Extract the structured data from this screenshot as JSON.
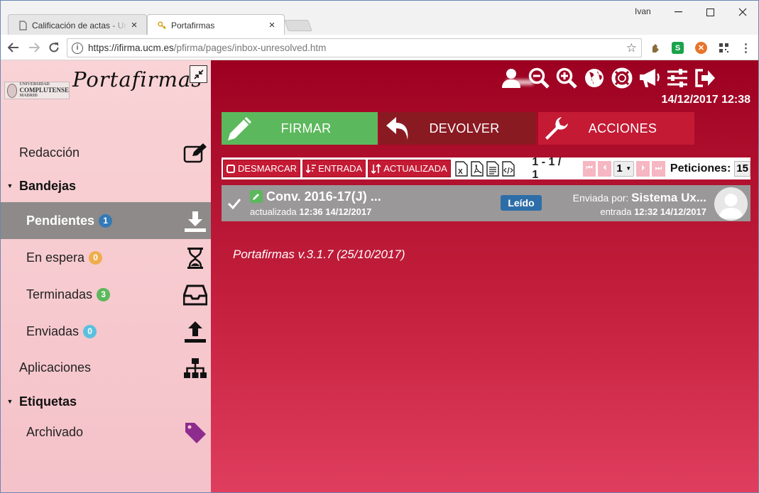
{
  "browser": {
    "tabs": [
      {
        "title": "Calificación de actas - Un",
        "icon": "document-icon"
      },
      {
        "title": "Portafirmas",
        "icon": "key-icon"
      }
    ],
    "tab_close": "×",
    "user": "Ivan",
    "url_host": "https://ifirma.ucm.es",
    "url_path": "/pfirma/pages/inbox-unresolved.htm",
    "window_controls": {
      "minimize": "—",
      "maximize": "☐",
      "close": "✕"
    }
  },
  "app": {
    "name": "Portafirmas",
    "university": {
      "line1": "UNIVERSIDAD",
      "line2": "COMPLUTENSE",
      "line3": "MADRID"
    },
    "datetime": "14/12/2017 12:38",
    "version": "Portafirmas v.3.1.7 (25/10/2017)"
  },
  "sidebar": {
    "redaccion": "Redacción",
    "bandejas": "Bandejas",
    "items": [
      {
        "label": "Pendientes",
        "count": "1",
        "color": "#337ab7",
        "icon": "download-icon"
      },
      {
        "label": "En espera",
        "count": "0",
        "color": "#f0ad4e",
        "icon": "hourglass-icon"
      },
      {
        "label": "Terminadas",
        "count": "3",
        "color": "#5cb85c",
        "icon": "inbox-tray-icon"
      },
      {
        "label": "Enviadas",
        "count": "0",
        "color": "#5bc0de",
        "icon": "upload-icon"
      }
    ],
    "aplicaciones": "Aplicaciones",
    "etiquetas": "Etiquetas",
    "archivado": "Archivado"
  },
  "actions": {
    "firmar": "FIRMAR",
    "devolver": "DEVOLVER",
    "acciones": "ACCIONES",
    "colors": {
      "firmar": "#5cb85c",
      "devolver": "#8a1a22",
      "acciones": "#c41a34"
    }
  },
  "listbar": {
    "desmarcar": "DESMARCAR",
    "entrada": "ENTRADA",
    "actualizada": "ACTUALIZADA",
    "range": "1 - 1 / 1",
    "page": "1",
    "peticiones_label": "Peticiones:",
    "peticiones_value": "15"
  },
  "request": {
    "title": "Conv. 2016-17(J) ...",
    "updated_label": "actualizada",
    "updated": "12:36 14/12/2017",
    "status": "Leído",
    "sent_by_label": "Enviada por:",
    "sent_by": "Sistema Ux...",
    "entry_label": "entrada",
    "entry": "12:32 14/12/2017"
  }
}
